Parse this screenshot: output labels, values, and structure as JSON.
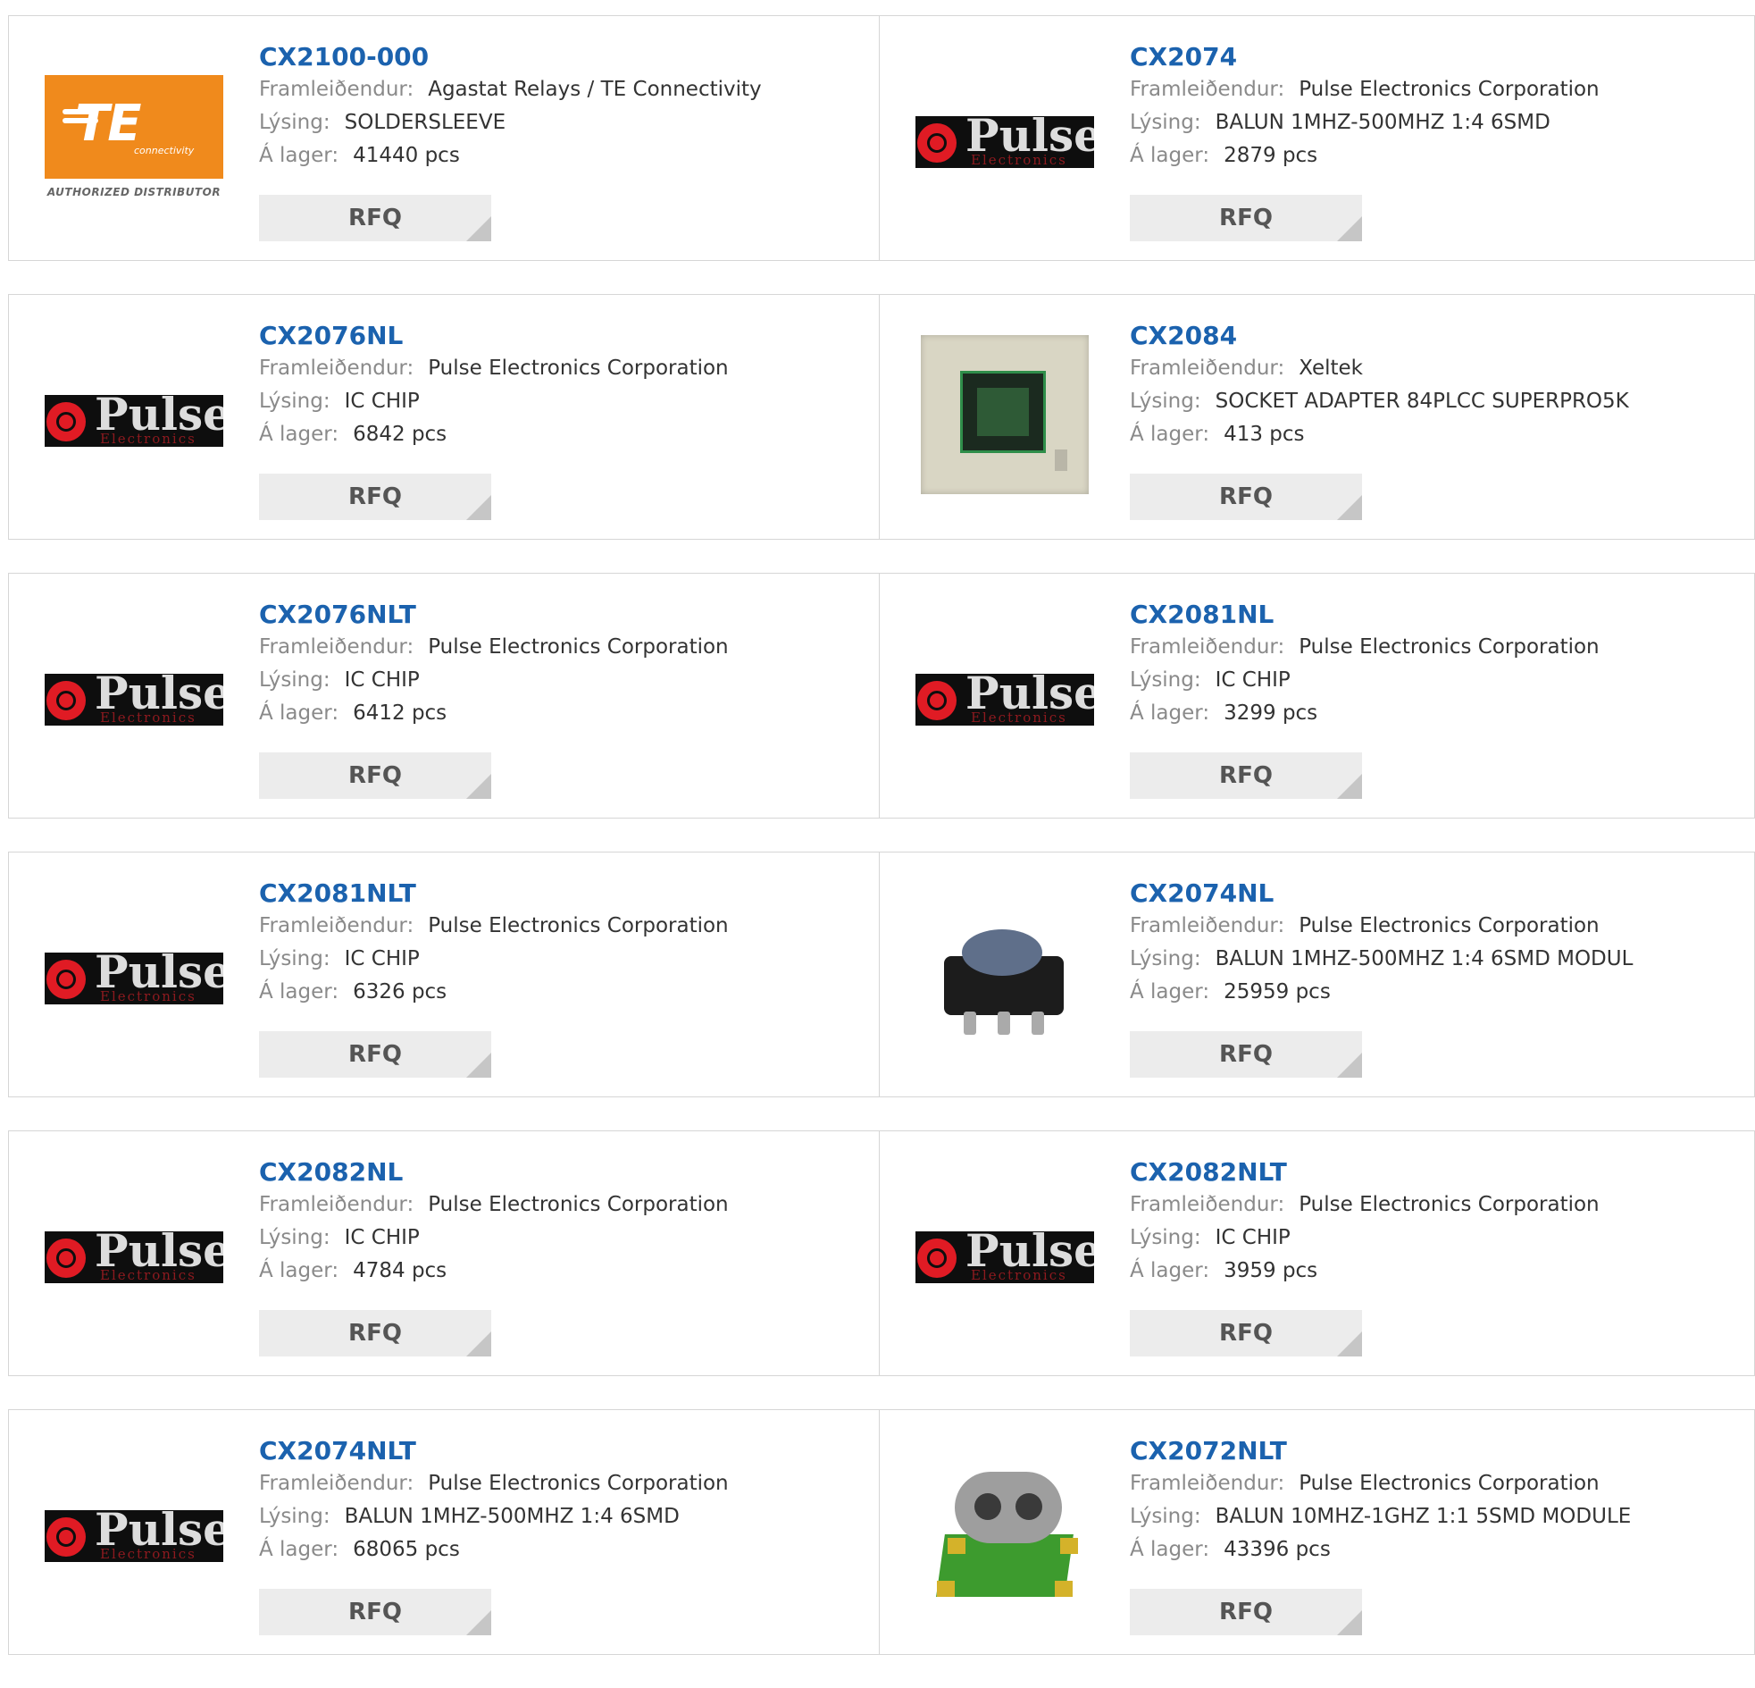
{
  "labels": {
    "manufacturer": "Framleiðendur:",
    "description": "Lýsing:",
    "stock": "Á lager:"
  },
  "rfq_label": "RFQ",
  "logos": {
    "te": {
      "letters": "TE",
      "tagline": "connectivity",
      "authorized": "AUTHORIZED DISTRIBUTOR",
      "color": "#f08a1c"
    },
    "pulse": {
      "word": "Pulse",
      "sub": "Electronics"
    }
  },
  "products": [
    {
      "pn": "CX2100-000",
      "manufacturer": "Agastat Relays / TE Connectivity",
      "description": "SOLDERSLEEVE",
      "stock": "41440 pcs",
      "image": "te-logo"
    },
    {
      "pn": "CX2074",
      "manufacturer": "Pulse Electronics Corporation",
      "description": "BALUN 1MHZ-500MHZ 1:4 6SMD",
      "stock": "2879 pcs",
      "image": "pulse-logo"
    },
    {
      "pn": "CX2076NL",
      "manufacturer": "Pulse Electronics Corporation",
      "description": "IC CHIP",
      "stock": "6842 pcs",
      "image": "pulse-logo"
    },
    {
      "pn": "CX2084",
      "manufacturer": "Xeltek",
      "description": "SOCKET ADAPTER 84PLCC SUPERPRO5K",
      "stock": "413 pcs",
      "image": "socket-photo"
    },
    {
      "pn": "CX2076NLT",
      "manufacturer": "Pulse Electronics Corporation",
      "description": "IC CHIP",
      "stock": "6412 pcs",
      "image": "pulse-logo"
    },
    {
      "pn": "CX2081NL",
      "manufacturer": "Pulse Electronics Corporation",
      "description": "IC CHIP",
      "stock": "3299 pcs",
      "image": "pulse-logo"
    },
    {
      "pn": "CX2081NLT",
      "manufacturer": "Pulse Electronics Corporation",
      "description": "IC CHIP",
      "stock": "6326 pcs",
      "image": "pulse-logo"
    },
    {
      "pn": "CX2074NL",
      "manufacturer": "Pulse Electronics Corporation",
      "description": "BALUN 1MHZ-500MHZ 1:4 6SMD MODUL",
      "stock": "25959 pcs",
      "image": "balun-photo"
    },
    {
      "pn": "CX2082NL",
      "manufacturer": "Pulse Electronics Corporation",
      "description": "IC CHIP",
      "stock": "4784 pcs",
      "image": "pulse-logo"
    },
    {
      "pn": "CX2082NLT",
      "manufacturer": "Pulse Electronics Corporation",
      "description": "IC CHIP",
      "stock": "3959 pcs",
      "image": "pulse-logo"
    },
    {
      "pn": "CX2074NLT",
      "manufacturer": "Pulse Electronics Corporation",
      "description": "BALUN 1MHZ-500MHZ 1:4 6SMD",
      "stock": "68065 pcs",
      "image": "pulse-logo"
    },
    {
      "pn": "CX2072NLT",
      "manufacturer": "Pulse Electronics Corporation",
      "description": "BALUN 10MHZ-1GHZ 1:1 5SMD MODULE",
      "stock": "43396 pcs",
      "image": "balun2-photo"
    }
  ],
  "colors": {
    "link": "#1b62ae",
    "label": "#8a8a8a",
    "value": "#333333",
    "button_bg": "#ececec",
    "border": "#d6d6d6"
  }
}
